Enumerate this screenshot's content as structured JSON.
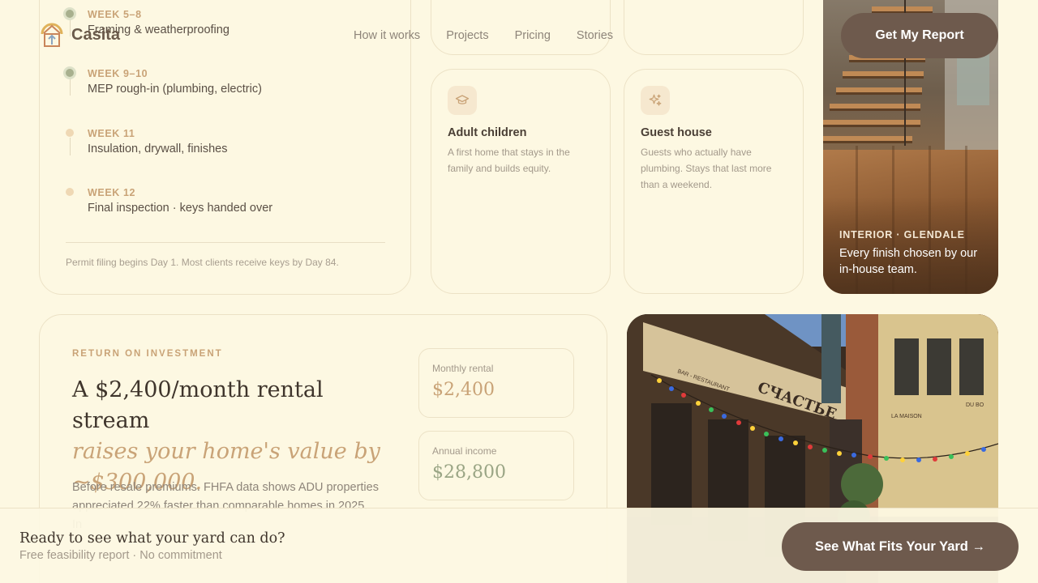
{
  "header": {
    "brand": "Casita",
    "nav": [
      "How it works",
      "Projects",
      "Pricing",
      "Stories"
    ],
    "cta_label": "Get My Report"
  },
  "timeline": {
    "items": [
      {
        "week": "WEEK 5–8",
        "text": "Framing & weatherproofing",
        "status": "done"
      },
      {
        "week": "WEEK 9–10",
        "text": "MEP rough-in (plumbing, electric)",
        "status": "done"
      },
      {
        "week": "WEEK 11",
        "text": "Insulation, drywall, finishes",
        "status": "upcoming"
      },
      {
        "week": "WEEK 12",
        "text": "Final inspection · keys handed over",
        "status": "upcoming"
      }
    ],
    "note": "Permit filing begins Day 1. Most clients receive keys by Day 84."
  },
  "use_cases": [
    {
      "icon": "graduation-cap-icon",
      "title": "Adult children",
      "desc": "A first home that stays in the family and builds equity."
    },
    {
      "icon": "sparkles-icon",
      "title": "Guest house",
      "desc": "Guests who actually have plumbing. Stays that last more than a weekend."
    }
  ],
  "photo": {
    "tag": "INTERIOR · GLENDALE",
    "caption": "Every finish chosen by our in-house team."
  },
  "roi": {
    "eyebrow": "RETURN ON INVESTMENT",
    "headline_plain": "A $2,400/month rental stream",
    "headline_accent": "raises your home's value by ~$300,000.",
    "body": "Before resale premiums. FHFA data shows ADU properties appreciated 22% faster than comparable homes in 2025. In",
    "stats": [
      {
        "label": "Monthly rental",
        "value": "$2,400",
        "color": "#c9a377"
      },
      {
        "label": "Annual income",
        "value": "$28,800",
        "color": "#9aa585"
      }
    ]
  },
  "street_photo": {
    "signs": [
      "BAR - RESTAURANT",
      "СЧАСТЬЕ",
      "LA MAISON",
      "DU BO"
    ]
  },
  "bottom_bar": {
    "title": "Ready to see what your yard can do?",
    "subtitle": "Free feasibility report · No commitment",
    "cta_label": "See What Fits Your Yard →"
  },
  "colors": {
    "background": "#fdf8e2",
    "accent": "#c9a377",
    "button": "#6e5a4d",
    "sage": "#9aa585"
  }
}
